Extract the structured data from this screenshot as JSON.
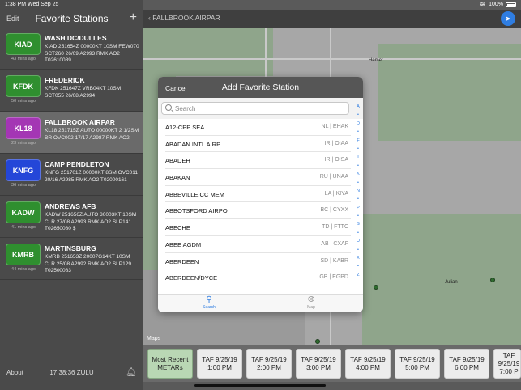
{
  "status_bar": {
    "time": "1:38 PM",
    "date": "Wed Sep 25",
    "battery_pct": "100%"
  },
  "sidebar": {
    "edit_label": "Edit",
    "title": "Favorite Stations",
    "add_label": "+",
    "stations": [
      {
        "id": "KIAD",
        "name": "WASH DC/DULLES",
        "metar": "KIAD 251654Z 00000KT 10SM FEW070 SCT260 26/09 A2993 RMK AO2 T02610089",
        "age": "43 mins ago",
        "color": "#2f8f2f"
      },
      {
        "id": "KFDK",
        "name": "FREDERICK",
        "metar": "KFDK 251647Z VRB04KT 10SM SCT055 26/08 A2994",
        "age": "50 mins ago",
        "color": "#2f8f2f"
      },
      {
        "id": "KL18",
        "name": "FALLBROOK AIRPAR",
        "metar": "KL18 251715Z AUTO 00000KT 2 1/2SM BR OVC002 17/17 A2987 RMK AO2",
        "age": "23 mins ago",
        "color": "#a436b4"
      },
      {
        "id": "KNFG",
        "name": "CAMP PENDLETON",
        "metar": "KNFG 251701Z 00000KT 8SM OVC011 20/16 A2985 RMK AO2 T02000161",
        "age": "36 mins ago",
        "color": "#2446d8"
      },
      {
        "id": "KADW",
        "name": "ANDREWS AFB",
        "metar": "KADW 251656Z AUTO 30003KT 10SM CLR 27/08 A2993 RMK AO2 SLP141 T02650080 $",
        "age": "41 mins ago",
        "color": "#2f8f2f"
      },
      {
        "id": "KMRB",
        "name": "MARTINSBURG",
        "metar": "KMRB 251653Z 20007G14KT 10SM CLR 25/08 A2992 RMK AO2 SLP129 T02500083",
        "age": "44 mins ago",
        "color": "#2f8f2f"
      }
    ],
    "about_label": "About",
    "zulu_time": "17:38:36 ZULU"
  },
  "nav": {
    "back_label": "FALLBROOK AIRPAR"
  },
  "map": {
    "legal": "Maps",
    "cities": [
      "Hemet",
      "Julian"
    ]
  },
  "forecast": {
    "buttons": [
      {
        "label": "Most Recent\nMETARs",
        "active": true
      },
      {
        "label": "TAF 9/25/19\n1:00 PM",
        "active": false
      },
      {
        "label": "TAF 9/25/19\n2:00 PM",
        "active": false
      },
      {
        "label": "TAF 9/25/19\n3:00 PM",
        "active": false
      },
      {
        "label": "TAF 9/25/19\n4:00 PM",
        "active": false
      },
      {
        "label": "TAF 9/25/19\n5:00 PM",
        "active": false
      },
      {
        "label": "TAF 9/25/19\n6:00 PM",
        "active": false
      },
      {
        "label": "TAF 9/25/19\n7:00 P",
        "active": false
      }
    ]
  },
  "modal": {
    "cancel_label": "Cancel",
    "title": "Add Favorite Station",
    "search_placeholder": "Search",
    "rows": [
      {
        "name": "A12-CPP SEA",
        "code": "NL | EHAK"
      },
      {
        "name": "ABADAN INTL AIRP",
        "code": "IR | OIAA"
      },
      {
        "name": "ABADEH",
        "code": "IR | OISA"
      },
      {
        "name": "ABAKAN",
        "code": "RU | UNAA"
      },
      {
        "name": "ABBEVILLE CC MEM",
        "code": "LA | KIYA"
      },
      {
        "name": "ABBOTSFORD AIRPO",
        "code": "BC | CYXX"
      },
      {
        "name": "ABECHE",
        "code": "TD | FTTC"
      },
      {
        "name": "ABEE AGDM",
        "code": "AB | CXAF"
      },
      {
        "name": "ABERDEEN",
        "code": "SD | KABR"
      },
      {
        "name": "ABERDEEN/DYCE",
        "code": "GB | EGPD"
      }
    ],
    "index": [
      "A",
      "•",
      "D",
      "•",
      "F",
      "•",
      "I",
      "•",
      "K",
      "•",
      "N",
      "•",
      "P",
      "•",
      "S",
      "•",
      "U",
      "•",
      "X",
      "•",
      "Z"
    ],
    "tabs": {
      "search": "Search",
      "map": "Map"
    }
  }
}
